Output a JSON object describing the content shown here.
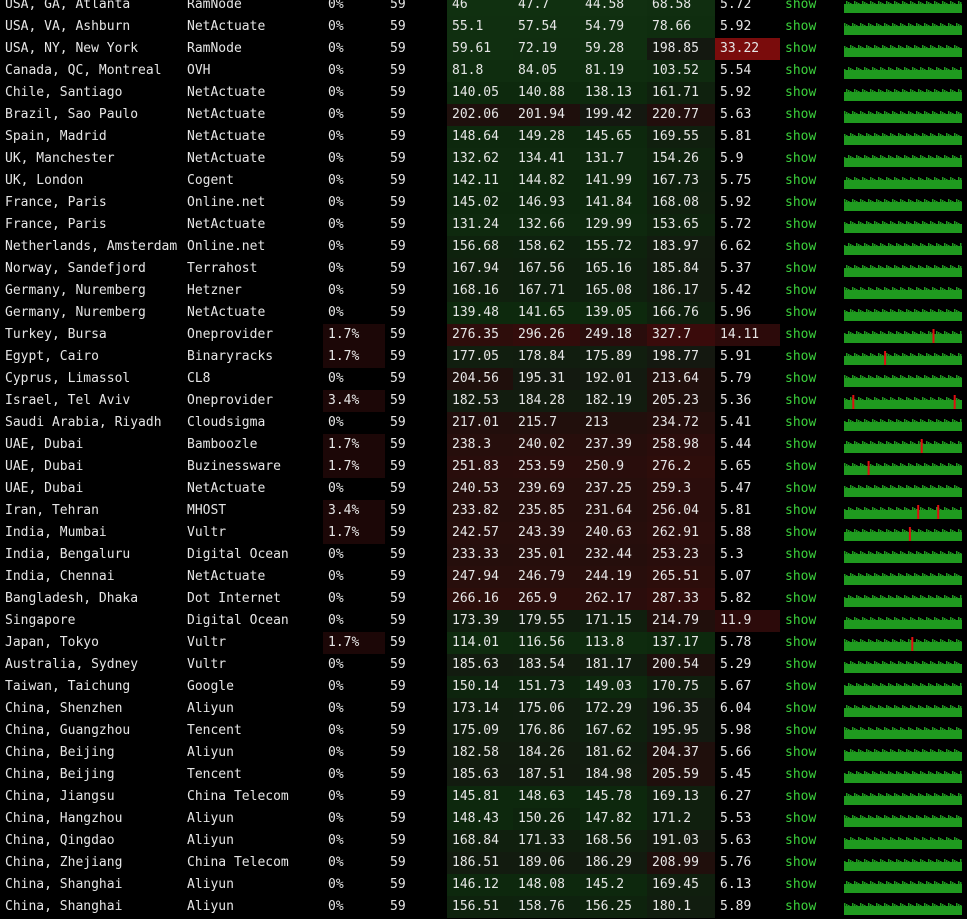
{
  "colors": {
    "background": "#000000",
    "text": "#e6e6e6",
    "show_link": "#3cd23c",
    "spark_bar": "#1f9a1f",
    "spark_spike": "#e01010",
    "good_cell": "#0b2a0b",
    "bad_cell": "#2c0909",
    "critical_cell": "#7a0c0c"
  },
  "show_label": "show",
  "rows": [
    {
      "location": "USA, GA, Atlanta",
      "provider": "RamNode",
      "loss": "0%",
      "sent": "59",
      "last": "46",
      "avg": "47.7",
      "best": "44.58",
      "worst": "68.58",
      "stdev": "5.72",
      "spikes": []
    },
    {
      "location": "USA, VA, Ashburn",
      "provider": "NetActuate",
      "loss": "0%",
      "sent": "59",
      "last": "55.1",
      "avg": "57.54",
      "best": "54.79",
      "worst": "78.66",
      "stdev": "5.92",
      "spikes": []
    },
    {
      "location": "USA, NY, New York",
      "provider": "RamNode",
      "loss": "0%",
      "sent": "59",
      "last": "59.61",
      "avg": "72.19",
      "best": "59.28",
      "worst": "198.85",
      "stdev": "33.22",
      "spikes": []
    },
    {
      "location": "Canada, QC, Montreal",
      "provider": "OVH",
      "loss": "0%",
      "sent": "59",
      "last": "81.8",
      "avg": "84.05",
      "best": "81.19",
      "worst": "103.52",
      "stdev": "5.54",
      "spikes": []
    },
    {
      "location": "Chile, Santiago",
      "provider": "NetActuate",
      "loss": "0%",
      "sent": "59",
      "last": "140.05",
      "avg": "140.88",
      "best": "138.13",
      "worst": "161.71",
      "stdev": "5.92",
      "spikes": []
    },
    {
      "location": "Brazil, Sao Paulo",
      "provider": "NetActuate",
      "loss": "0%",
      "sent": "59",
      "last": "202.06",
      "avg": "201.94",
      "best": "199.42",
      "worst": "220.77",
      "stdev": "5.63",
      "spikes": []
    },
    {
      "location": "Spain, Madrid",
      "provider": "NetActuate",
      "loss": "0%",
      "sent": "59",
      "last": "148.64",
      "avg": "149.28",
      "best": "145.65",
      "worst": "169.55",
      "stdev": "5.81",
      "spikes": []
    },
    {
      "location": "UK, Manchester",
      "provider": "NetActuate",
      "loss": "0%",
      "sent": "59",
      "last": "132.62",
      "avg": "134.41",
      "best": "131.7",
      "worst": "154.26",
      "stdev": "5.9",
      "spikes": []
    },
    {
      "location": "UK, London",
      "provider": "Cogent",
      "loss": "0%",
      "sent": "59",
      "last": "142.11",
      "avg": "144.82",
      "best": "141.99",
      "worst": "167.73",
      "stdev": "5.75",
      "spikes": []
    },
    {
      "location": "France, Paris",
      "provider": "Online.net",
      "loss": "0%",
      "sent": "59",
      "last": "145.02",
      "avg": "146.93",
      "best": "141.84",
      "worst": "168.08",
      "stdev": "5.92",
      "spikes": []
    },
    {
      "location": "France, Paris",
      "provider": "NetActuate",
      "loss": "0%",
      "sent": "59",
      "last": "131.24",
      "avg": "132.66",
      "best": "129.99",
      "worst": "153.65",
      "stdev": "5.72",
      "spikes": []
    },
    {
      "location": "Netherlands, Amsterdam",
      "provider": "Online.net",
      "loss": "0%",
      "sent": "59",
      "last": "156.68",
      "avg": "158.62",
      "best": "155.72",
      "worst": "183.97",
      "stdev": "6.62",
      "spikes": []
    },
    {
      "location": "Norway, Sandefjord",
      "provider": "Terrahost",
      "loss": "0%",
      "sent": "59",
      "last": "167.94",
      "avg": "167.56",
      "best": "165.16",
      "worst": "185.84",
      "stdev": "5.37",
      "spikes": []
    },
    {
      "location": "Germany, Nuremberg",
      "provider": "Hetzner",
      "loss": "0%",
      "sent": "59",
      "last": "168.16",
      "avg": "167.71",
      "best": "165.08",
      "worst": "186.17",
      "stdev": "5.42",
      "spikes": []
    },
    {
      "location": "Germany, Nuremberg",
      "provider": "NetActuate",
      "loss": "0%",
      "sent": "59",
      "last": "139.48",
      "avg": "141.65",
      "best": "139.05",
      "worst": "166.76",
      "stdev": "5.96",
      "spikes": []
    },
    {
      "location": "Turkey, Bursa",
      "provider": "Oneprovider",
      "loss": "1.7%",
      "sent": "59",
      "last": "276.35",
      "avg": "296.26",
      "best": "249.18",
      "worst": "327.7",
      "stdev": "14.11",
      "spikes": [
        0.75
      ]
    },
    {
      "location": "Egypt, Cairo",
      "provider": "Binaryracks",
      "loss": "1.7%",
      "sent": "59",
      "last": "177.05",
      "avg": "178.84",
      "best": "175.89",
      "worst": "198.77",
      "stdev": "5.91",
      "spikes": [
        0.34
      ]
    },
    {
      "location": "Cyprus, Limassol",
      "provider": "CL8",
      "loss": "0%",
      "sent": "59",
      "last": "204.56",
      "avg": "195.31",
      "best": "192.01",
      "worst": "213.64",
      "stdev": "5.79",
      "spikes": []
    },
    {
      "location": "Israel, Tel Aviv",
      "provider": "Oneprovider",
      "loss": "3.4%",
      "sent": "59",
      "last": "182.53",
      "avg": "184.28",
      "best": "182.19",
      "worst": "205.23",
      "stdev": "5.36",
      "spikes": [
        0.07,
        0.93
      ]
    },
    {
      "location": "Saudi Arabia, Riyadh",
      "provider": "Cloudsigma",
      "loss": "0%",
      "sent": "59",
      "last": "217.01",
      "avg": "215.7",
      "best": "213",
      "worst": "234.72",
      "stdev": "5.41",
      "spikes": []
    },
    {
      "location": "UAE, Dubai",
      "provider": "Bamboozle",
      "loss": "1.7%",
      "sent": "59",
      "last": "238.3",
      "avg": "240.02",
      "best": "237.39",
      "worst": "258.98",
      "stdev": "5.44",
      "spikes": [
        0.65
      ]
    },
    {
      "location": "UAE, Dubai",
      "provider": "Buzinessware",
      "loss": "1.7%",
      "sent": "59",
      "last": "251.83",
      "avg": "253.59",
      "best": "250.9",
      "worst": "276.2",
      "stdev": "5.65",
      "spikes": [
        0.2
      ]
    },
    {
      "location": "UAE, Dubai",
      "provider": "NetActuate",
      "loss": "0%",
      "sent": "59",
      "last": "240.53",
      "avg": "239.69",
      "best": "237.25",
      "worst": "259.3",
      "stdev": "5.47",
      "spikes": []
    },
    {
      "location": "Iran, Tehran",
      "provider": "MHOST",
      "loss": "3.4%",
      "sent": "59",
      "last": "233.82",
      "avg": "235.85",
      "best": "231.64",
      "worst": "256.04",
      "stdev": "5.81",
      "spikes": [
        0.62,
        0.79
      ]
    },
    {
      "location": "India, Mumbai",
      "provider": "Vultr",
      "loss": "1.7%",
      "sent": "59",
      "last": "242.57",
      "avg": "243.39",
      "best": "240.63",
      "worst": "262.91",
      "stdev": "5.88",
      "spikes": [
        0.55
      ]
    },
    {
      "location": "India, Bengaluru",
      "provider": "Digital Ocean",
      "loss": "0%",
      "sent": "59",
      "last": "233.33",
      "avg": "235.01",
      "best": "232.44",
      "worst": "253.23",
      "stdev": "5.3",
      "spikes": []
    },
    {
      "location": "India, Chennai",
      "provider": "NetActuate",
      "loss": "0%",
      "sent": "59",
      "last": "247.94",
      "avg": "246.79",
      "best": "244.19",
      "worst": "265.51",
      "stdev": "5.07",
      "spikes": []
    },
    {
      "location": "Bangladesh, Dhaka",
      "provider": "Dot Internet",
      "loss": "0%",
      "sent": "59",
      "last": "266.16",
      "avg": "265.9",
      "best": "262.17",
      "worst": "287.33",
      "stdev": "5.82",
      "spikes": []
    },
    {
      "location": "Singapore",
      "provider": "Digital Ocean",
      "loss": "0%",
      "sent": "59",
      "last": "173.39",
      "avg": "179.55",
      "best": "171.15",
      "worst": "214.79",
      "stdev": "11.9",
      "spikes": []
    },
    {
      "location": "Japan, Tokyo",
      "provider": "Vultr",
      "loss": "1.7%",
      "sent": "59",
      "last": "114.01",
      "avg": "116.56",
      "best": "113.8",
      "worst": "137.17",
      "stdev": "5.78",
      "spikes": [
        0.57
      ]
    },
    {
      "location": "Australia, Sydney",
      "provider": "Vultr",
      "loss": "0%",
      "sent": "59",
      "last": "185.63",
      "avg": "183.54",
      "best": "181.17",
      "worst": "200.54",
      "stdev": "5.29",
      "spikes": []
    },
    {
      "location": "Taiwan, Taichung",
      "provider": "Google",
      "loss": "0%",
      "sent": "59",
      "last": "150.14",
      "avg": "151.73",
      "best": "149.03",
      "worst": "170.75",
      "stdev": "5.67",
      "spikes": []
    },
    {
      "location": "China, Shenzhen",
      "provider": "Aliyun",
      "loss": "0%",
      "sent": "59",
      "last": "173.14",
      "avg": "175.06",
      "best": "172.29",
      "worst": "196.35",
      "stdev": "6.04",
      "spikes": []
    },
    {
      "location": "China, Guangzhou",
      "provider": "Tencent",
      "loss": "0%",
      "sent": "59",
      "last": "175.09",
      "avg": "176.86",
      "best": "167.62",
      "worst": "195.95",
      "stdev": "5.98",
      "spikes": []
    },
    {
      "location": "China, Beijing",
      "provider": "Aliyun",
      "loss": "0%",
      "sent": "59",
      "last": "182.58",
      "avg": "184.26",
      "best": "181.62",
      "worst": "204.37",
      "stdev": "5.66",
      "spikes": []
    },
    {
      "location": "China, Beijing",
      "provider": "Tencent",
      "loss": "0%",
      "sent": "59",
      "last": "185.63",
      "avg": "187.51",
      "best": "184.98",
      "worst": "205.59",
      "stdev": "5.45",
      "spikes": []
    },
    {
      "location": "China, Jiangsu",
      "provider": "China Telecom",
      "loss": "0%",
      "sent": "59",
      "last": "145.81",
      "avg": "148.63",
      "best": "145.78",
      "worst": "169.13",
      "stdev": "6.27",
      "spikes": []
    },
    {
      "location": "China, Hangzhou",
      "provider": "Aliyun",
      "loss": "0%",
      "sent": "59",
      "last": "148.43",
      "avg": "150.26",
      "best": "147.82",
      "worst": "171.2",
      "stdev": "5.53",
      "spikes": []
    },
    {
      "location": "China, Qingdao",
      "provider": "Aliyun",
      "loss": "0%",
      "sent": "59",
      "last": "168.84",
      "avg": "171.33",
      "best": "168.56",
      "worst": "191.03",
      "stdev": "5.63",
      "spikes": []
    },
    {
      "location": "China, Zhejiang",
      "provider": "China Telecom",
      "loss": "0%",
      "sent": "59",
      "last": "186.51",
      "avg": "189.06",
      "best": "186.29",
      "worst": "208.99",
      "stdev": "5.76",
      "spikes": []
    },
    {
      "location": "China, Shanghai",
      "provider": "Aliyun",
      "loss": "0%",
      "sent": "59",
      "last": "146.12",
      "avg": "148.08",
      "best": "145.2",
      "worst": "169.45",
      "stdev": "6.13",
      "spikes": []
    },
    {
      "location": "China, Shanghai",
      "provider": "Aliyun",
      "loss": "0%",
      "sent": "59",
      "last": "156.51",
      "avg": "158.76",
      "best": "156.25",
      "worst": "180.1",
      "stdev": "5.89",
      "spikes": []
    }
  ]
}
